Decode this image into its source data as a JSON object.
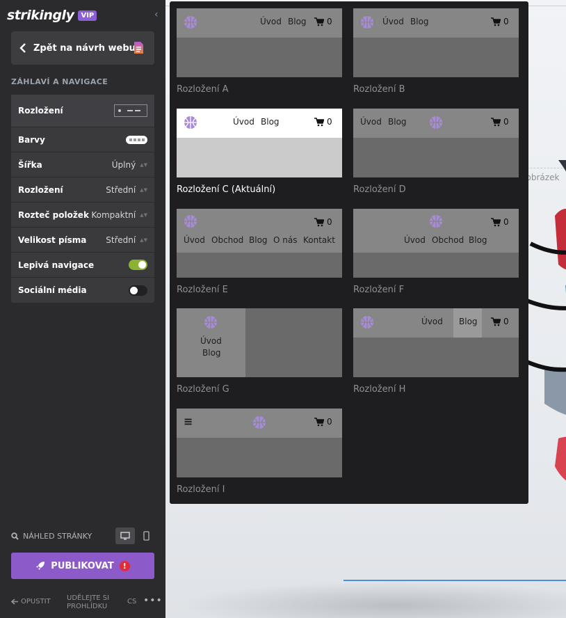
{
  "sidebar": {
    "brand": "strikingly",
    "badge": "VIP",
    "back_label": "Zpět na návrh webu",
    "section_title": "ZÁHLAVÍ A NAVIGACE",
    "rows": [
      {
        "label": "Rozložení",
        "value": ""
      },
      {
        "label": "Barvy",
        "value": ""
      },
      {
        "label": "Šířka",
        "value": "Úplný"
      },
      {
        "label": "Rozložení",
        "value": "Střední"
      },
      {
        "label": "Rozteč položek",
        "value": "Kompaktní"
      },
      {
        "label": "Velikost písma",
        "value": "Střední"
      },
      {
        "label": "Lepivá navigace",
        "value": "on"
      },
      {
        "label": "Sociální média",
        "value": "off"
      }
    ],
    "preview_label": "NÁHLED STRÁNKY",
    "publish_label": "PUBLIKOVAT",
    "publish_warning": "!",
    "footer": {
      "leave": "OPUSTIT",
      "tour_line1": "UDĚLEJTE SI",
      "tour_line2": "PROHLÍDKU",
      "lang": "CS",
      "more": "•••"
    }
  },
  "layouts": {
    "captions": [
      "Rozložení A",
      "Rozložení B",
      "Rozložení C (Aktuální)",
      "Rozložení D",
      "Rozložení E",
      "Rozložení F",
      "Rozložení G",
      "Rozložení H",
      "Rozložení I"
    ],
    "nav": {
      "home": "Úvod",
      "blog": "Blog",
      "shop": "Obchod",
      "about": "O nás",
      "contact": "Kontakt",
      "cart_count": "0",
      "menu": "≡"
    }
  },
  "preview": {
    "hint_text": "t obrázek"
  },
  "colors": {
    "accent": "#8c5ac9",
    "toggle_on": "#8ab233",
    "logo_purple": "#a78bd8"
  }
}
